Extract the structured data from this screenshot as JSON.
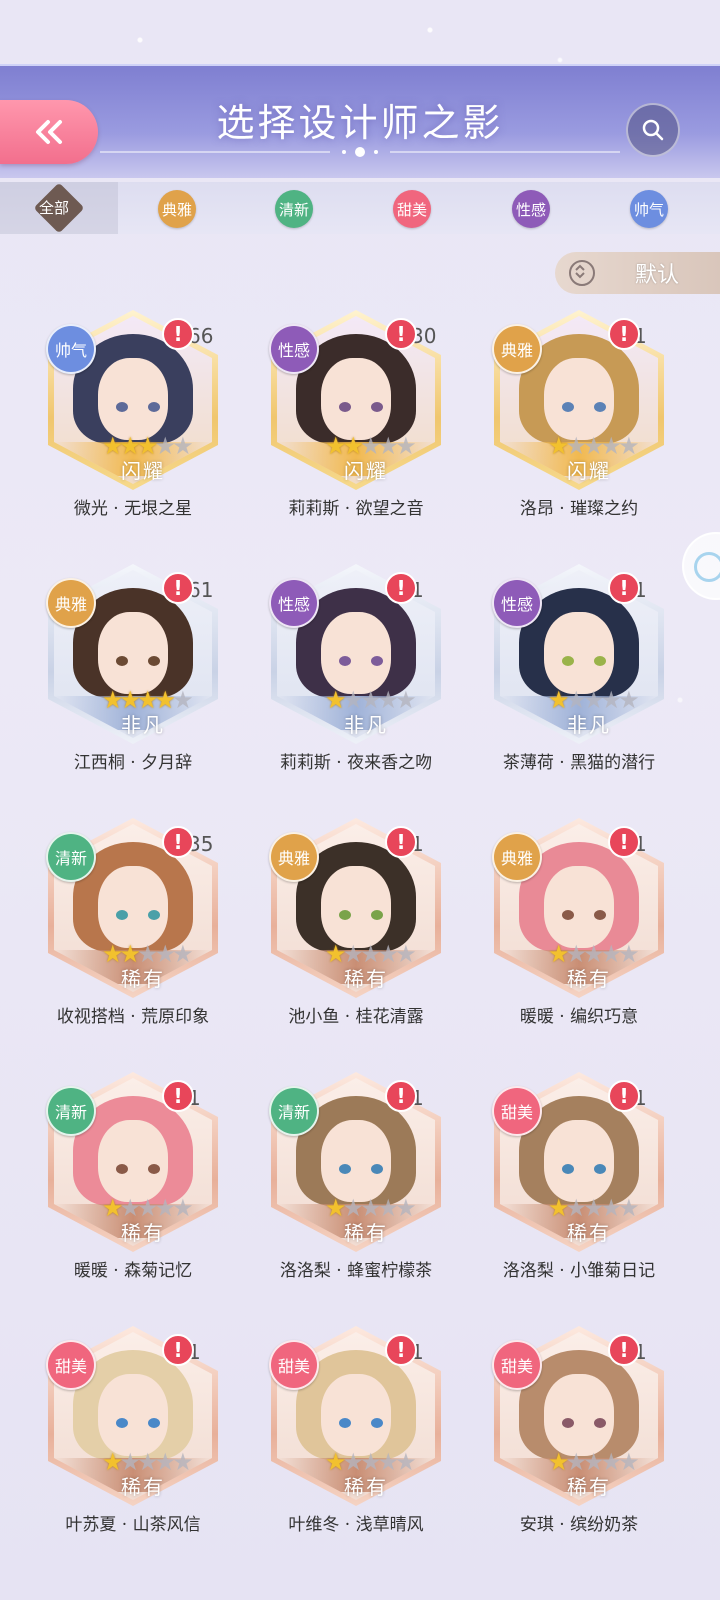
{
  "header": {
    "title": "选择设计师之影",
    "back_icon": "double-chevron-left-icon",
    "search_icon": "search-icon"
  },
  "tabs": [
    {
      "label": "全部",
      "color": "#6e5a52",
      "selected": true
    },
    {
      "label": "典雅",
      "color": "#e0a24a"
    },
    {
      "label": "清新",
      "color": "#4fb383"
    },
    {
      "label": "甜美",
      "color": "#f0667e"
    },
    {
      "label": "性感",
      "color": "#8e5bb8"
    },
    {
      "label": "帅气",
      "color": "#6d8ee0"
    }
  ],
  "sort": {
    "label": "默认"
  },
  "cards": [
    {
      "category": "帅气",
      "cat_color": "#6d8ee0",
      "count": "66",
      "stars": 3,
      "max_stars": 5,
      "rarity": "闪耀",
      "name": "微光 · 无垠之星",
      "frame": "gold",
      "hair": "#3a3f5e",
      "eye": "#5d6a99"
    },
    {
      "category": "性感",
      "cat_color": "#8e5bb8",
      "count": "30",
      "stars": 2,
      "max_stars": 5,
      "rarity": "闪耀",
      "name": "莉莉斯 · 欲望之音",
      "frame": "gold",
      "hair": "#3b2c2a",
      "eye": "#7a5a8c"
    },
    {
      "category": "典雅",
      "cat_color": "#e0a24a",
      "count": "1",
      "stars": 1,
      "max_stars": 5,
      "rarity": "闪耀",
      "name": "洛昂 · 璀璨之约",
      "frame": "gold",
      "hair": "#c79a55",
      "eye": "#5c82b6"
    },
    {
      "category": "典雅",
      "cat_color": "#e0a24a",
      "count": "61",
      "stars": 4,
      "max_stars": 5,
      "rarity": "非凡",
      "name": "江西桐 · 夕月辞",
      "frame": "silver",
      "hair": "#4a3328",
      "eye": "#6b4a34"
    },
    {
      "category": "性感",
      "cat_color": "#8e5bb8",
      "count": "1",
      "stars": 1,
      "max_stars": 5,
      "rarity": "非凡",
      "name": "莉莉斯 · 夜来香之吻",
      "frame": "silver",
      "hair": "#3e3048",
      "eye": "#7d5c9a"
    },
    {
      "category": "性感",
      "cat_color": "#8e5bb8",
      "count": "1",
      "stars": 1,
      "max_stars": 5,
      "rarity": "非凡",
      "name": "茶薄荷 · 黑猫的潜行",
      "frame": "silver",
      "hair": "#27304a",
      "eye": "#9ab34a"
    },
    {
      "category": "清新",
      "cat_color": "#4fb383",
      "count": "35",
      "stars": 2,
      "max_stars": 5,
      "rarity": "稀有",
      "name": "收视搭档 · 荒原印象",
      "frame": "bronze",
      "hair": "#b8764c",
      "eye": "#4aa0a8"
    },
    {
      "category": "典雅",
      "cat_color": "#e0a24a",
      "count": "1",
      "stars": 1,
      "max_stars": 5,
      "rarity": "稀有",
      "name": "池小鱼 · 桂花清露",
      "frame": "bronze",
      "hair": "#3c3028",
      "eye": "#7aa34a"
    },
    {
      "category": "典雅",
      "cat_color": "#e0a24a",
      "count": "1",
      "stars": 1,
      "max_stars": 5,
      "rarity": "稀有",
      "name": "暖暖 · 编织巧意",
      "frame": "bronze",
      "hair": "#e98a96",
      "eye": "#8a5a48"
    },
    {
      "category": "清新",
      "cat_color": "#4fb383",
      "count": "1",
      "stars": 1,
      "max_stars": 5,
      "rarity": "稀有",
      "name": "暖暖 · 森菊记忆",
      "frame": "bronze",
      "hair": "#ec8b98",
      "eye": "#8a5a48"
    },
    {
      "category": "清新",
      "cat_color": "#4fb383",
      "count": "1",
      "stars": 1,
      "max_stars": 5,
      "rarity": "稀有",
      "name": "洛洛梨 · 蜂蜜柠檬茶",
      "frame": "bronze",
      "hair": "#9c7a58",
      "eye": "#4a88b8"
    },
    {
      "category": "甜美",
      "cat_color": "#f0667e",
      "count": "1",
      "stars": 1,
      "max_stars": 5,
      "rarity": "稀有",
      "name": "洛洛梨 · 小雏菊日记",
      "frame": "bronze",
      "hair": "#a5805e",
      "eye": "#4a88b8"
    },
    {
      "category": "甜美",
      "cat_color": "#f0667e",
      "count": "1",
      "stars": 1,
      "max_stars": 5,
      "rarity": "稀有",
      "name": "叶苏夏 · 山茶风信",
      "frame": "bronze",
      "hair": "#e4cfa8",
      "eye": "#4a88c8"
    },
    {
      "category": "甜美",
      "cat_color": "#f0667e",
      "count": "1",
      "stars": 1,
      "max_stars": 5,
      "rarity": "稀有",
      "name": "叶维冬 · 浅草晴风",
      "frame": "bronze",
      "hair": "#e0c59a",
      "eye": "#4a88c8"
    },
    {
      "category": "甜美",
      "cat_color": "#f0667e",
      "count": "1",
      "stars": 1,
      "max_stars": 5,
      "rarity": "稀有",
      "name": "安琪 · 缤纷奶茶",
      "frame": "bronze",
      "hair": "#b88c6c",
      "eye": "#8a5a68"
    }
  ]
}
